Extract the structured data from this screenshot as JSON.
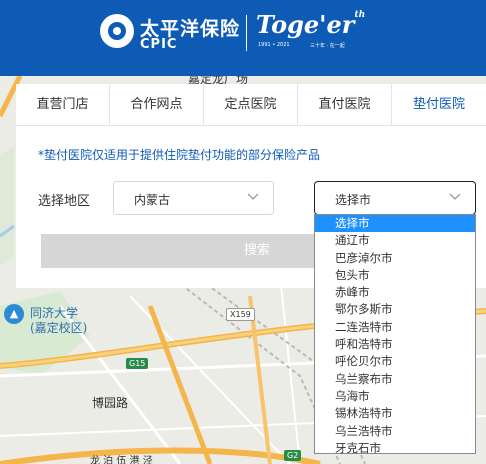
{
  "header": {
    "brand_cn": "太平洋保险",
    "brand_en": "CPIC",
    "together": "Toge'er",
    "together_sup": "th",
    "years": "1991 • 2021",
    "slogan": "三十年 · 在一起",
    "color": "#0d5bb5"
  },
  "map": {
    "labels": {
      "top_road": "嘉定龙厂场",
      "university": "同济大学",
      "campus": "(嘉定校区)",
      "road": "博园路",
      "bottom_road": "龙 泊 伍 港 泾",
      "badge_g15": "G15",
      "badge_x159": "X159",
      "badge_g2": "G2"
    }
  },
  "tabs": [
    {
      "label": "直营门店",
      "active": false
    },
    {
      "label": "合作网点",
      "active": false
    },
    {
      "label": "定点医院",
      "active": false
    },
    {
      "label": "直付医院",
      "active": false
    },
    {
      "label": "垫付医院",
      "active": true
    }
  ],
  "notice": "*垫付医院仅适用于提供住院垫付功能的部分保险产品",
  "region": {
    "label": "选择地区",
    "province_value": "内蒙古",
    "city_value": "选择市"
  },
  "search_label": "搜索",
  "city_options": [
    {
      "label": "选择市",
      "selected": true
    },
    {
      "label": "通辽市",
      "selected": false
    },
    {
      "label": "巴彦淖尔市",
      "selected": false
    },
    {
      "label": "包头市",
      "selected": false
    },
    {
      "label": "赤峰市",
      "selected": false
    },
    {
      "label": "鄂尔多斯市",
      "selected": false
    },
    {
      "label": "二连浩特市",
      "selected": false
    },
    {
      "label": "呼和浩特市",
      "selected": false
    },
    {
      "label": "呼伦贝尔市",
      "selected": false
    },
    {
      "label": "乌兰察布市",
      "selected": false
    },
    {
      "label": "乌海市",
      "selected": false
    },
    {
      "label": "锡林浩特市",
      "selected": false
    },
    {
      "label": "乌兰浩特市",
      "selected": false
    },
    {
      "label": "牙克石市",
      "selected": false
    }
  ]
}
